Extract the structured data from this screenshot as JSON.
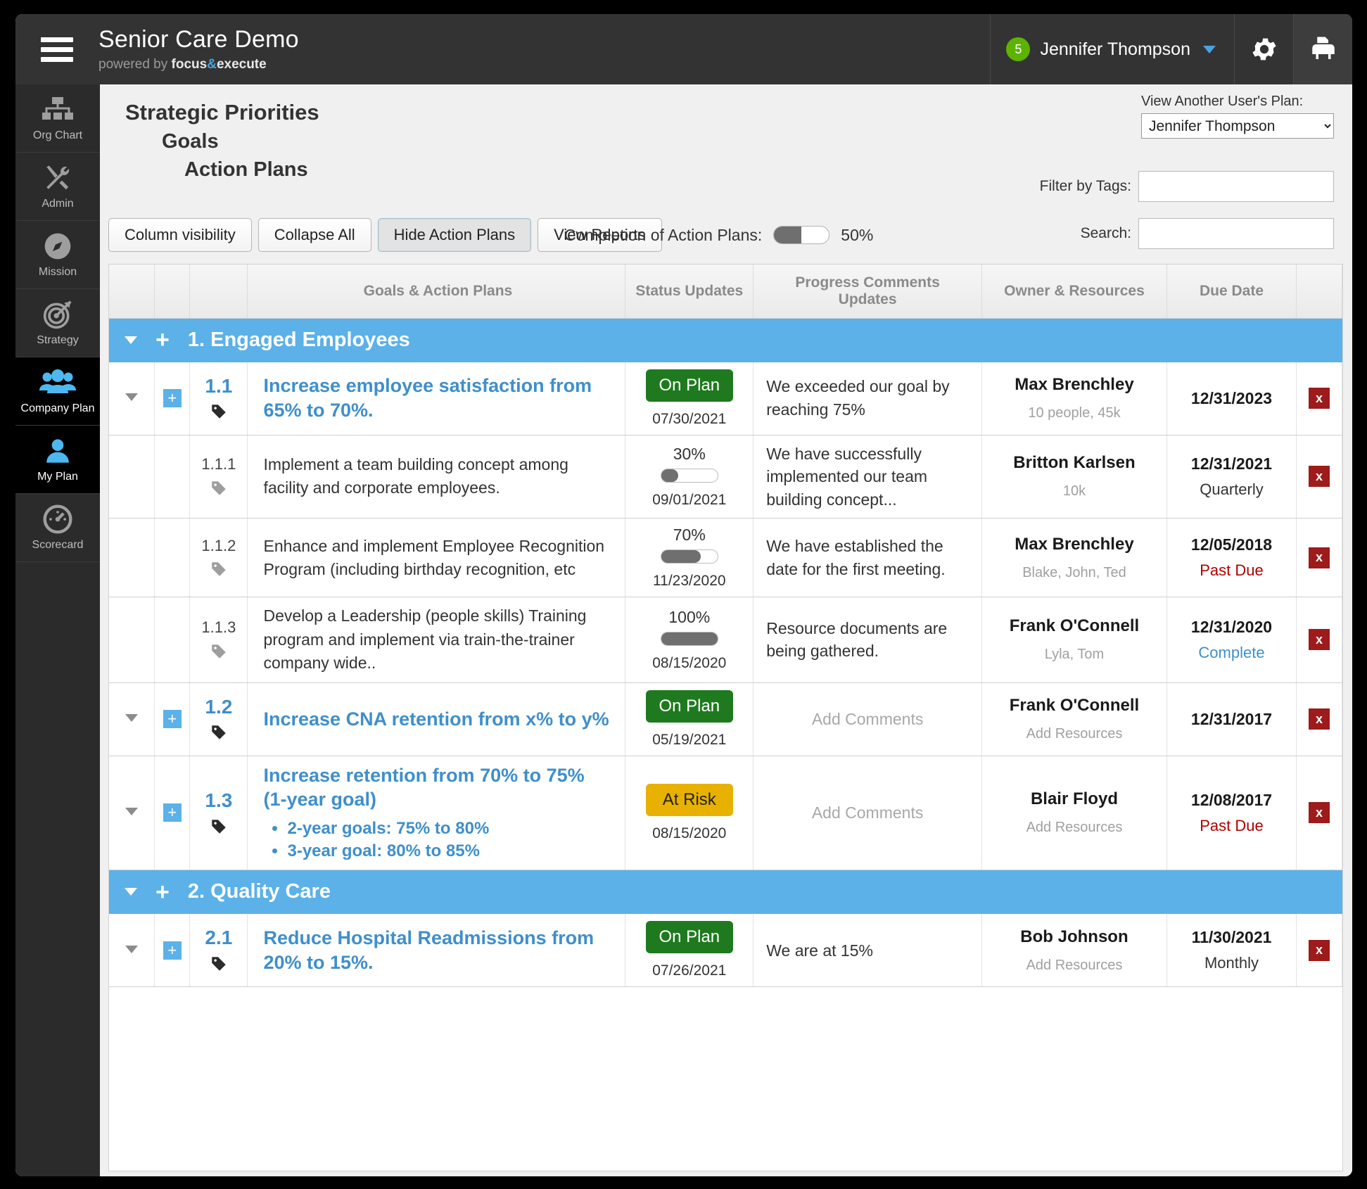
{
  "header": {
    "title": "Senior Care Demo",
    "powered_prefix": "powered by ",
    "powered_focus": "focus",
    "powered_amp": "&",
    "powered_execute": "execute",
    "notification_count": "5",
    "user_name": "Jennifer Thompson"
  },
  "sidebar": {
    "items": [
      {
        "label": "Org Chart",
        "icon": "org-chart-icon",
        "active": false
      },
      {
        "label": "Admin",
        "icon": "tools-icon",
        "active": false
      },
      {
        "label": "Mission",
        "icon": "compass-icon",
        "active": false
      },
      {
        "label": "Strategy",
        "icon": "target-icon",
        "active": false
      },
      {
        "label": "Company Plan",
        "icon": "people-group-icon",
        "active": true
      },
      {
        "label": "My Plan",
        "icon": "person-icon",
        "active": true
      },
      {
        "label": "Scorecard",
        "icon": "gauge-icon",
        "active": false
      }
    ]
  },
  "page": {
    "title_line1": "Strategic Priorities",
    "title_line2": "Goals",
    "title_line3": "Action Plans"
  },
  "view_user": {
    "label": "View Another User's Plan:",
    "selected": "Jennifer Thompson",
    "options": [
      "Jennifer Thompson"
    ]
  },
  "filters": {
    "tags_label": "Filter by Tags:",
    "tags_value": "",
    "search_label": "Search:",
    "search_value": ""
  },
  "toolbar": {
    "column_visibility": "Column visibility",
    "collapse_all": "Collapse All",
    "hide_action_plans": "Hide Action Plans",
    "view_reports": "View Reports",
    "completion_label": "Completion of Action Plans:",
    "completion_pct": "50%",
    "completion_value": 50
  },
  "table": {
    "headers": {
      "goals": "Goals & Action Plans",
      "status": "Status Updates",
      "progress": "Progress Comments Updates",
      "owner": "Owner & Resources",
      "due": "Due Date"
    },
    "groups": [
      {
        "title": "1. Engaged Employees",
        "rows": [
          {
            "type": "goal",
            "number": "1.1",
            "text": "Increase employee satisfaction from 65% to 70%.",
            "status_kind": "pill",
            "status_label": "On Plan",
            "status_date": "07/30/2021",
            "comment": "We exceeded our goal by reaching 75%",
            "comment_placeholder": false,
            "owner": "Max Brenchley",
            "resources": "10 people, 45k",
            "due_date": "12/31/2023",
            "due_sub": "",
            "due_sub_kind": ""
          },
          {
            "type": "plan",
            "number": "1.1.1",
            "text": "Implement a team building concept among facility and corporate employees.",
            "status_kind": "progress",
            "status_label": "30%",
            "status_value": 30,
            "status_date": "09/01/2021",
            "comment": "We have successfully implemented our team building concept...",
            "comment_placeholder": false,
            "owner": "Britton Karlsen",
            "resources": "10k",
            "due_date": "12/31/2021",
            "due_sub": "Quarterly",
            "due_sub_kind": "normal"
          },
          {
            "type": "plan",
            "number": "1.1.2",
            "text": "Enhance and implement Employee Recognition Program (including birthday recognition, etc",
            "status_kind": "progress",
            "status_label": "70%",
            "status_value": 70,
            "status_date": "11/23/2020",
            "comment": "We have established the date for the first meeting.",
            "comment_placeholder": false,
            "owner": "Max Brenchley",
            "resources": "Blake, John, Ted",
            "due_date": "12/05/2018",
            "due_sub": "Past Due",
            "due_sub_kind": "past"
          },
          {
            "type": "plan",
            "number": "1.1.3",
            "text": "Develop a Leadership (people skills) Training program and implement via train-the-trainer company wide..",
            "status_kind": "progress",
            "status_label": "100%",
            "status_value": 100,
            "status_date": "08/15/2020",
            "comment": "Resource documents are being gathered.",
            "comment_placeholder": false,
            "owner": "Frank O'Connell",
            "resources": "Lyla, Tom",
            "due_date": "12/31/2020",
            "due_sub": "Complete",
            "due_sub_kind": "complete"
          },
          {
            "type": "goal",
            "number": "1.2",
            "text": "Increase CNA retention from x% to y%",
            "status_kind": "pill",
            "status_label": "On Plan",
            "status_date": "05/19/2021",
            "comment": "Add Comments",
            "comment_placeholder": true,
            "owner": "Frank O'Connell",
            "resources": "Add Resources",
            "due_date": "12/31/2017",
            "due_sub": "",
            "due_sub_kind": ""
          },
          {
            "type": "goal",
            "number": "1.3",
            "text": "Increase retention from 70% to 75% (1-year goal)",
            "bullets": [
              "2-year goals: 75% to 80%",
              "3-year goal:  80% to 85%"
            ],
            "status_kind": "pill-risk",
            "status_label": "At Risk",
            "status_date": "08/15/2020",
            "comment": "Add Comments",
            "comment_placeholder": true,
            "owner": "Blair Floyd",
            "resources": "Add Resources",
            "due_date": "12/08/2017",
            "due_sub": "Past Due",
            "due_sub_kind": "past"
          }
        ]
      },
      {
        "title": "2. Quality Care",
        "rows": [
          {
            "type": "goal",
            "number": "2.1",
            "text": "Reduce Hospital Readmissions from 20% to 15%.",
            "status_kind": "pill",
            "status_label": "On Plan",
            "status_date": "07/26/2021",
            "comment": "We are at 15%",
            "comment_placeholder": false,
            "owner": "Bob Johnson",
            "resources": "Add Resources",
            "due_date": "11/30/2021",
            "due_sub": "Monthly",
            "due_sub_kind": "normal"
          }
        ]
      }
    ]
  },
  "colors": {
    "accent_blue": "#5bb1e8",
    "link_blue": "#3f8fcb",
    "on_plan_green": "#1f7a1f",
    "at_risk_yellow": "#e8b100",
    "past_due_red": "#b00000",
    "delete_red": "#9e1b1b",
    "badge_green": "#5cb300"
  }
}
